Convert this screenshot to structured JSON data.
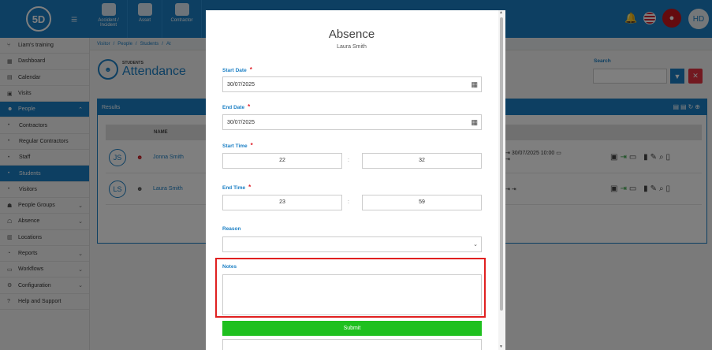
{
  "app": {
    "logo": "5D"
  },
  "topnav": [
    {
      "label": "Accident / Incident"
    },
    {
      "label": "Asset"
    },
    {
      "label": "Contractor"
    }
  ],
  "user": {
    "initials": "HD"
  },
  "sidebar": {
    "items": [
      {
        "label": "Liam's training",
        "icon": "fork-icon"
      },
      {
        "label": "Dashboard",
        "icon": "grid-icon"
      },
      {
        "label": "Calendar",
        "icon": "calendar-icon"
      },
      {
        "label": "Visits",
        "icon": "visits-icon"
      },
      {
        "label": "People",
        "icon": "people-icon",
        "active": true
      },
      {
        "label": "Contractors",
        "sub": true
      },
      {
        "label": "Regular Contractors",
        "sub": true
      },
      {
        "label": "Staff",
        "sub": true
      },
      {
        "label": "Students",
        "sub": true,
        "active": true
      },
      {
        "label": "Visitors",
        "sub": true
      },
      {
        "label": "People Groups",
        "icon": "group-icon"
      },
      {
        "label": "Absence",
        "icon": "absence-icon"
      },
      {
        "label": "Locations",
        "icon": "building-icon"
      },
      {
        "label": "Reports",
        "icon": "report-icon"
      },
      {
        "label": "Workflows",
        "icon": "workflow-icon"
      },
      {
        "label": "Configuration",
        "icon": "config-icon"
      },
      {
        "label": "Help and Support",
        "icon": "help-icon"
      }
    ]
  },
  "breadcrumb": {
    "visitor": "Visitor",
    "people": "People",
    "students": "Students",
    "at": "At"
  },
  "page": {
    "supertitle": "STUDENTS",
    "title": "Attendance"
  },
  "search": {
    "label": "Search"
  },
  "results": {
    "title": "Results",
    "column_name": "NAME",
    "rows": [
      {
        "initials": "JS",
        "name": "Jonna Smith",
        "in_out": "30/07/2025 10:00"
      },
      {
        "initials": "LS",
        "name": "Laura Smith",
        "in_out": ""
      }
    ]
  },
  "modal": {
    "title": "Absence",
    "subtitle": "Laura Smith",
    "start_date_label": "Start Date",
    "start_date_value": "30/07/2025",
    "end_date_label": "End Date",
    "end_date_value": "30/07/2025",
    "start_time_label": "Start Time",
    "start_hour": "22",
    "start_minute": "32",
    "end_time_label": "End Time",
    "end_hour": "23",
    "end_minute": "59",
    "time_separator": ":",
    "reason_label": "Reason",
    "reason_value": "",
    "notes_label": "Notes",
    "notes_value": "",
    "submit_label": "Submit",
    "required_mark": "*"
  },
  "colors": {
    "brand": "#1b7fc4",
    "submit": "#1fc01f",
    "highlight": "#e02020"
  }
}
